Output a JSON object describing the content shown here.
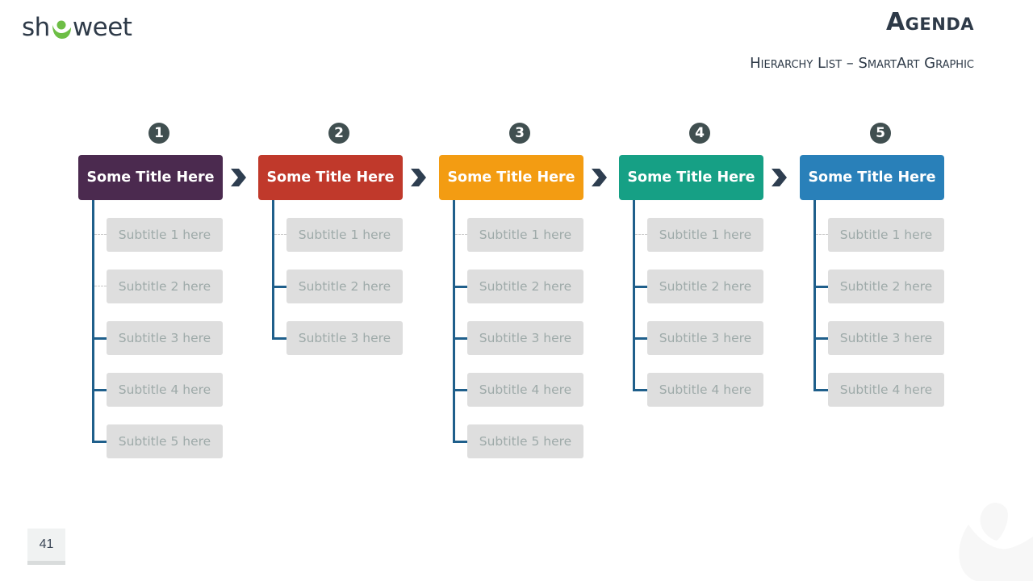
{
  "logo": {
    "text_before": "sh",
    "text_after": "weet",
    "mark_icon": "showeet-o-icon",
    "mark_color": "#6dbe45"
  },
  "header": {
    "title": "Agenda",
    "subtitle": "Hierarchy List – SmartArt Graphic"
  },
  "columns": [
    {
      "number": "1",
      "title": "Some Title Here",
      "color": "#4b2a4f",
      "subtitles": [
        "Subtitle 1 here",
        "Subtitle 2 here",
        "Subtitle 3 here",
        "Subtitle 4 here",
        "Subtitle 5 here"
      ],
      "connector_styles": [
        "dashed",
        "dashed",
        "solid",
        "solid",
        "solid"
      ]
    },
    {
      "number": "2",
      "title": "Some Title Here",
      "color": "#c0392b",
      "subtitles": [
        "Subtitle 1 here",
        "Subtitle 2 here",
        "Subtitle 3 here"
      ],
      "connector_styles": [
        "dashed",
        "solid",
        "solid"
      ]
    },
    {
      "number": "3",
      "title": "Some Title Here",
      "color": "#f39c12",
      "subtitles": [
        "Subtitle 1 here",
        "Subtitle 2 here",
        "Subtitle 3 here",
        "Subtitle 4 here",
        "Subtitle 5 here"
      ],
      "connector_styles": [
        "dashed",
        "solid",
        "solid",
        "solid",
        "solid"
      ]
    },
    {
      "number": "4",
      "title": "Some Title Here",
      "color": "#16a085",
      "subtitles": [
        "Subtitle 1 here",
        "Subtitle 2 here",
        "Subtitle 3 here",
        "Subtitle 4 here"
      ],
      "connector_styles": [
        "dashed",
        "solid",
        "solid",
        "solid"
      ]
    },
    {
      "number": "5",
      "title": "Some Title Here",
      "color": "#2980b9",
      "subtitles": [
        "Subtitle 1 here",
        "Subtitle 2 here",
        "Subtitle 3 here",
        "Subtitle 4 here"
      ],
      "connector_styles": [
        "dashed",
        "solid",
        "solid",
        "solid"
      ]
    }
  ],
  "arrow_icon": "chevron-right-icon",
  "arrow_color": "#2e3e50",
  "connector_color": "#1f5f8b",
  "page_number": "41"
}
